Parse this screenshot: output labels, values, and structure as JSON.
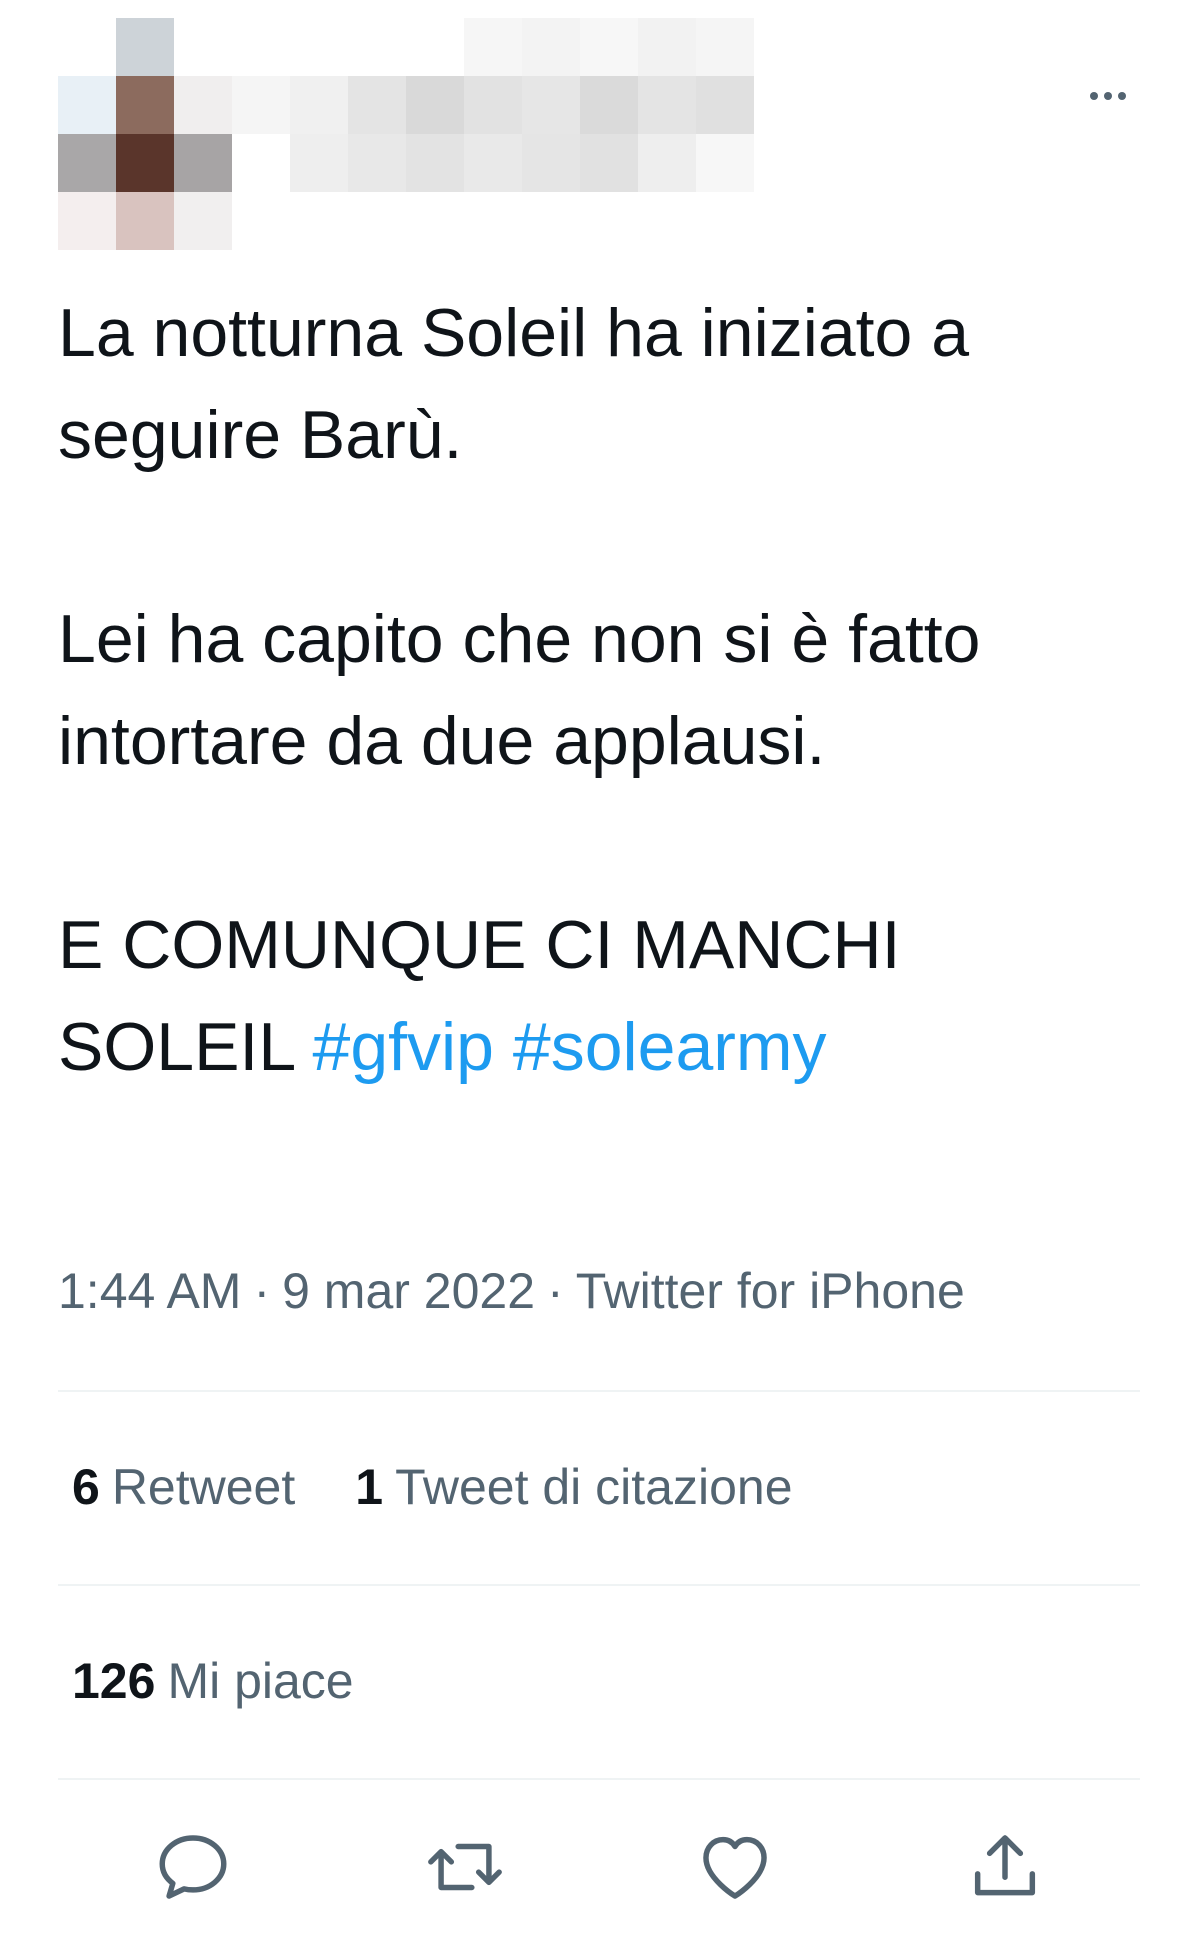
{
  "header": {
    "avatar_icon": "pixelated-avatar",
    "more_icon": "more-horizontal-icon"
  },
  "tweet": {
    "paragraphs": [
      [
        "La notturna Soleil ha iniziato a seguire Barù."
      ],
      [
        "Lei ha capito che non si è fatto intortare da due applausi."
      ]
    ],
    "last_text": "E COMUNQUE CI MANCHI SOLEIL",
    "hashtags": [
      "#gfvip",
      "#solearmy"
    ],
    "time": "1:44 AM",
    "date": "9 mar 2022",
    "source": "Twitter for iPhone",
    "separator": "·"
  },
  "stats": {
    "retweets": {
      "count": "6",
      "label": "Retweet"
    },
    "quotes": {
      "count": "1",
      "label": "Tweet di citazione"
    },
    "likes": {
      "count": "126",
      "label": "Mi piace"
    }
  },
  "actions": {
    "reply_icon": "reply-icon",
    "retweet_icon": "retweet-icon",
    "like_icon": "heart-icon",
    "share_icon": "share-icon"
  },
  "colors": {
    "text": "#0f1419",
    "secondary": "#536471",
    "hashtag": "#1d9bf0",
    "divider": "#eff3f4"
  }
}
